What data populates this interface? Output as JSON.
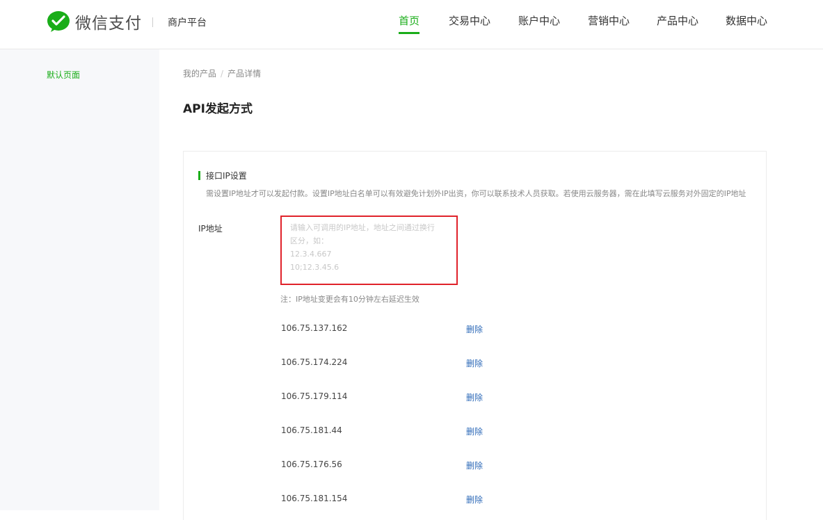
{
  "header": {
    "logo_text": "微信支付",
    "platform_name": "商户平台",
    "nav": [
      {
        "label": "首页",
        "active": true
      },
      {
        "label": "交易中心",
        "active": false
      },
      {
        "label": "账户中心",
        "active": false
      },
      {
        "label": "营销中心",
        "active": false
      },
      {
        "label": "产品中心",
        "active": false
      },
      {
        "label": "数据中心",
        "active": false
      }
    ]
  },
  "sidebar": {
    "items": [
      {
        "label": "默认页面"
      }
    ]
  },
  "breadcrumb": {
    "items": [
      "我的产品",
      "产品详情"
    ],
    "separator": "/"
  },
  "page_title": "API发起方式",
  "section": {
    "title": "接口IP设置",
    "description": "需设置IP地址才可以发起付款。设置IP地址白名单可以有效避免计划外IP出资，你可以联系技术人员获取。若使用云服务器，需在此填写云服务对外固定的IP地址",
    "ip_label": "IP地址",
    "placeholder_lines": [
      "请输入可调用的IP地址，地址之间通过换行",
      "区分，如：",
      "12.3.4.667",
      "10;12.3.45.6"
    ],
    "note": "注：IP地址变更会有10分钟左右延迟生效",
    "ips": [
      {
        "address": "106.75.137.162",
        "action": "删除"
      },
      {
        "address": "106.75.174.224",
        "action": "删除"
      },
      {
        "address": "106.75.179.114",
        "action": "删除"
      },
      {
        "address": "106.75.181.44",
        "action": "删除"
      },
      {
        "address": "106.75.176.56",
        "action": "删除"
      },
      {
        "address": "106.75.181.154",
        "action": "删除"
      }
    ]
  },
  "colors": {
    "brand_green": "#1aad19",
    "link_blue": "#2e6ab8",
    "highlight_red": "#e0222a"
  }
}
